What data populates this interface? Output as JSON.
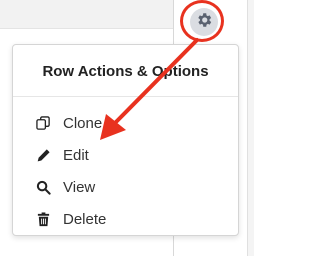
{
  "menu": {
    "title": "Row Actions & Options",
    "items": [
      {
        "label": "Clone",
        "icon": "clone-icon"
      },
      {
        "label": "Edit",
        "icon": "pencil-icon"
      },
      {
        "label": "View",
        "icon": "search-icon"
      },
      {
        "label": "Delete",
        "icon": "trash-icon"
      }
    ]
  },
  "colors": {
    "annotation": "#e8321f",
    "gear_button_bg": "#dadde2",
    "icon": "#222222"
  },
  "icons": {
    "settings_button": "gear-icon"
  }
}
